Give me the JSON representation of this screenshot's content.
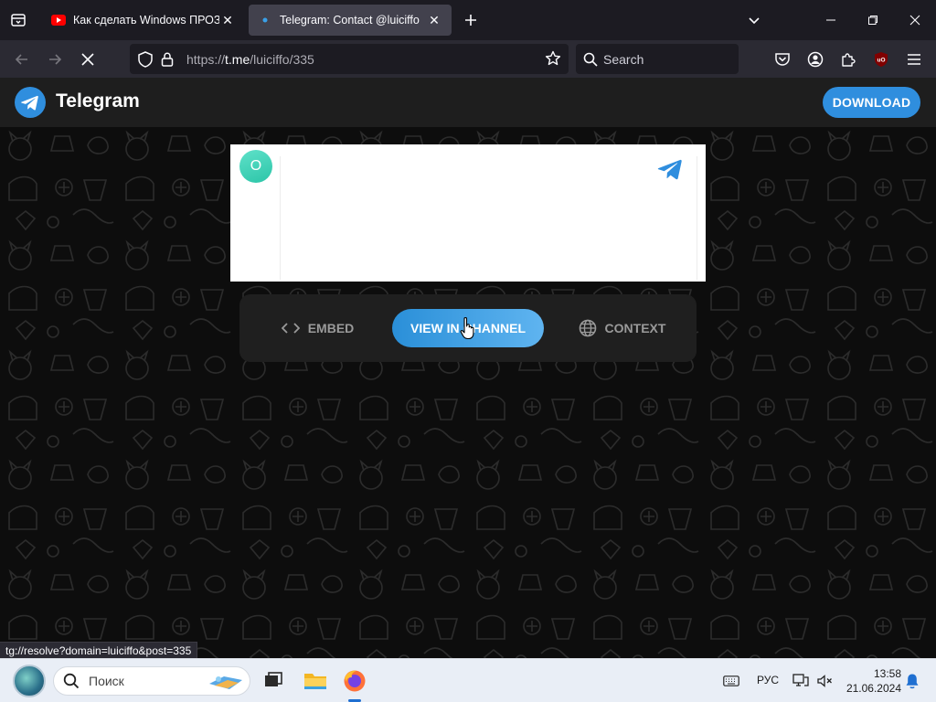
{
  "browser": {
    "tabs": [
      {
        "title": "Как сделать Windows ПРОЗРА",
        "favicon": "youtube-icon"
      },
      {
        "title": "Telegram: Contact @luiciffo",
        "favicon": "loading-dot-icon",
        "active": true
      }
    ],
    "url": {
      "scheme": "https://",
      "host": "t.me",
      "path": "/luiciffo/335"
    },
    "search_placeholder": "Search",
    "status_url": "tg://resolve?domain=luiciffo&post=335",
    "extension_badge": "uO"
  },
  "telegram": {
    "brand": "Telegram",
    "download_label": "DOWNLOAD",
    "avatar_letter": "O",
    "actions": {
      "embed_label": "EMBED",
      "view_label": "VIEW IN CHANNEL",
      "context_label": "CONTEXT"
    },
    "colors": {
      "accent": "#2f8ede",
      "header_bg": "#1e1e1e",
      "avatar": "#3fd3b8"
    }
  },
  "taskbar": {
    "search_placeholder": "Поиск",
    "language": "РУС",
    "time": "13:58",
    "date": "21.06.2024"
  }
}
